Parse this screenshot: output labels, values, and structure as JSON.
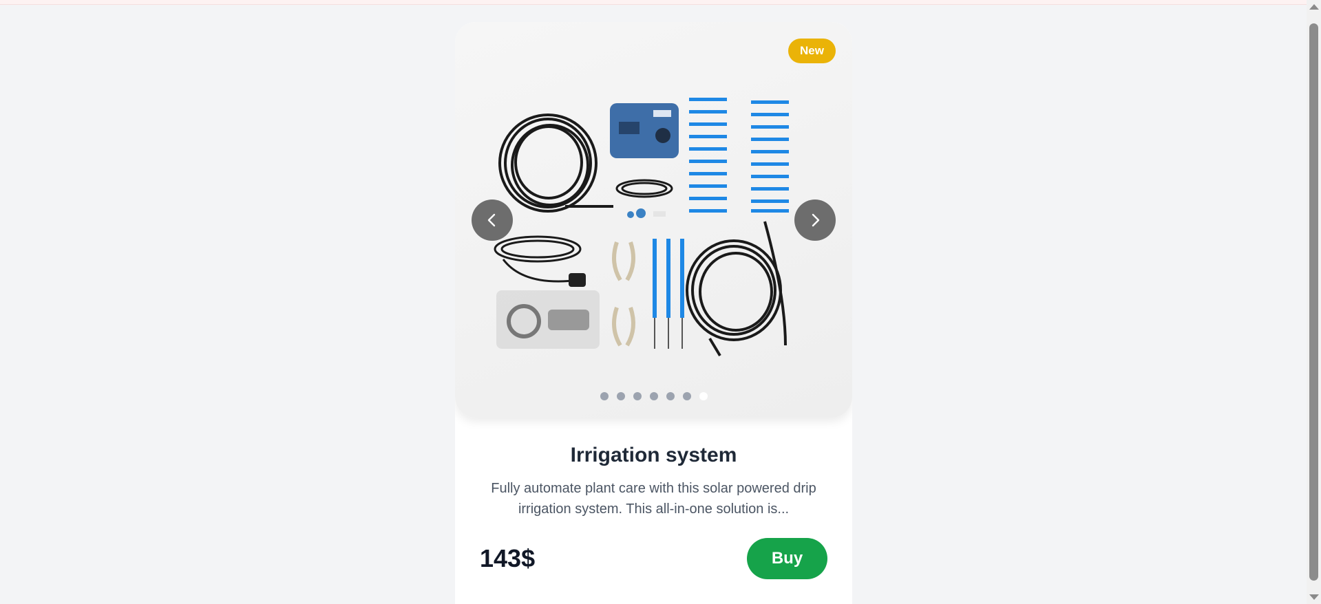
{
  "product": {
    "badge": "New",
    "title": "Irrigation system",
    "description": "Fully automate plant care with this solar powered drip irrigation system. This all-in-one solution is...",
    "price": "143$",
    "buy_label": "Buy",
    "image_icon": "irrigation-kit-photo"
  },
  "carousel": {
    "slide_count": 7,
    "active_index": 6,
    "prev_icon": "chevron-left-icon",
    "next_icon": "chevron-right-icon"
  },
  "colors": {
    "badge": "#eab308",
    "buy_button": "#16a34a",
    "background": "#f3f4f6",
    "dot_inactive": "#9ca3af",
    "dot_active": "#ffffff"
  }
}
